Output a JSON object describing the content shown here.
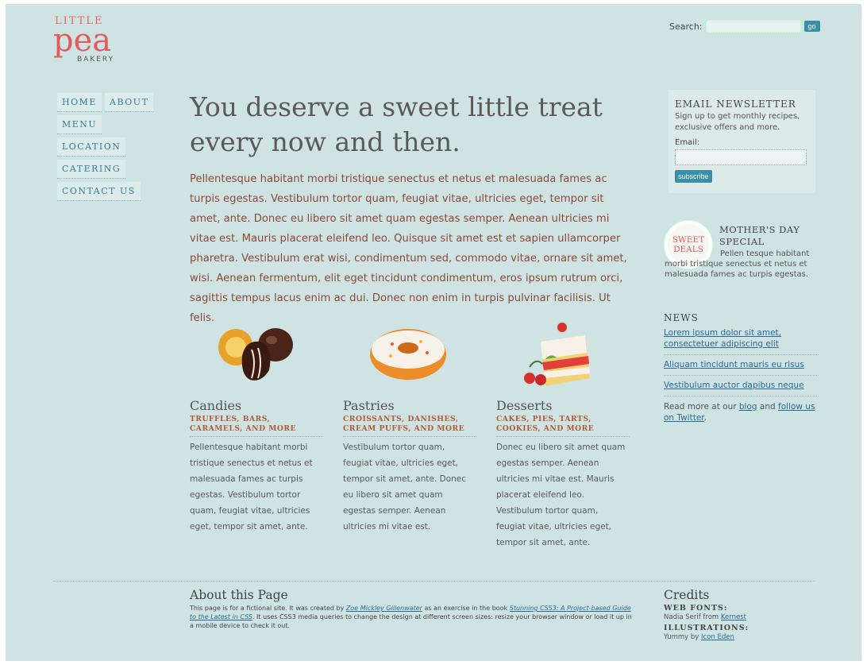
{
  "logo": {
    "little": "LITTLE",
    "pea": "pea",
    "bakery": "BAKERY"
  },
  "search": {
    "label": "Search:",
    "button": "go",
    "value": ""
  },
  "nav": [
    {
      "label": "HOME"
    },
    {
      "label": "ABOUT"
    },
    {
      "label": "MENU"
    },
    {
      "label": "LOCATION"
    },
    {
      "label": "CATERING"
    },
    {
      "label": "CONTACT US"
    }
  ],
  "main": {
    "headline_line1": "You deserve a sweet little treat",
    "headline_line2": "every now and then.",
    "intro": "Pellentesque habitant morbi tristique senectus et netus et malesuada fames ac turpis egestas. Vestibulum tortor quam, feugiat vitae, ultricies eget, tempor sit amet, ante. Donec eu libero sit amet quam egestas semper. Aenean ultricies mi vitae est. Mauris placerat eleifend leo. Quisque sit amet est et sapien ullamcorper pharetra. Vestibulum erat wisi, condimentum sed, commodo vitae, ornare sit amet, wisi. Aenean fermentum, elit eget tincidunt condimentum, eros ipsum rutrum orci, sagittis tempus lacus enim ac dui. Donec non enim in turpis pulvinar facilisis. Ut felis."
  },
  "categories": [
    {
      "title": "Candies",
      "subtitle": "TRUFFLES, BARS, CARAMELS, AND MORE",
      "text": "Pellentesque habitant morbi tristique senectus et netus et malesuada fames ac turpis egestas. Vestibulum tortor quam, feugiat vitae, ultricies eget, tempor sit amet, ante."
    },
    {
      "title": "Pastries",
      "subtitle": "CROISSANTS, DANISHES, CREAM PUFFS, AND MORE",
      "text": "Vestibulum tortor quam, feugiat vitae, ultricies eget, tempor sit amet, ante. Donec eu libero sit amet quam egestas semper. Aenean ultricies mi vitae est."
    },
    {
      "title": "Desserts",
      "subtitle": "CAKES, PIES, TARTS, COOKIES, AND MORE",
      "text": "Donec eu libero sit amet quam egestas semper. Aenean ultricies mi vitae est. Mauris placerat eleifend leo. Vestibulum tortor quam, feugiat vitae, ultricies eget, tempor sit amet, ante."
    }
  ],
  "newsletter": {
    "title": "EMAIL NEWSLETTER",
    "text": "Sign up to get monthly recipes, exclusive offers and more.",
    "email_label": "Email:",
    "button": "subscribe"
  },
  "special": {
    "badge_line1": "SWEET",
    "badge_line2": "DEALS",
    "title_line1": "MOTHER'S DAY",
    "title_line2": "SPECIAL",
    "text": "Pellen tesque habitant morbi tristique senectus et netus et malesuada fames ac turpis egestas."
  },
  "news": {
    "title": "NEWS",
    "links": [
      "Lorem ipsum dolor sit amet, consectetuer adipiscing elit",
      "Aliquam tincidunt mauris eu risus",
      "Vestibulum auctor dapibus neque"
    ],
    "more_prefix": "Read more at our ",
    "blog": "blog",
    "and": " and ",
    "twitter": "follow us on Twitter",
    "end": "."
  },
  "about": {
    "title": "About this Page",
    "t1": "This page is for a fictional site. It was created by ",
    "author": "Zoe Mickley Gillenwater",
    "t2": " as an exercise in the book ",
    "book": "Stunning CSS3: A Project-based Guide to the Latest in CSS",
    "t3": ". It uses CSS3 media queries to change the design at different screen sizes: resize your browser window or load it up in a mobile device to check it out."
  },
  "credits": {
    "title": "Credits",
    "fonts_heading": "WEB FONTS:",
    "fonts_text": "Nadia Serif from ",
    "fonts_link": "Kernest",
    "illus_heading": "ILLUSTRATIONS:",
    "illus_text": "Yummy by ",
    "illus_link": "Icon Eden"
  },
  "colors": {
    "background": "#cfe3e2",
    "accent": "#3a8fa8",
    "logo": "#e05c5c",
    "intro_text": "#8a4a3a"
  }
}
